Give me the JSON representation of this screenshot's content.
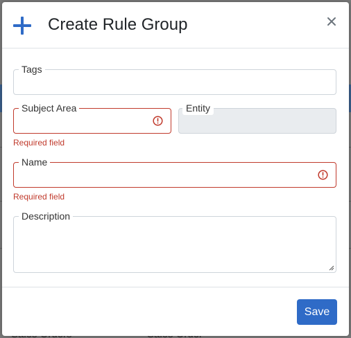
{
  "background": {
    "row_text_left": "Sales Orders",
    "row_text_right": "Sales Order",
    "row_menu": "..."
  },
  "dialog": {
    "title": "Create Rule Group",
    "icon": "plus-icon",
    "close_icon": "close-icon",
    "accent_color": "#2f6bc7",
    "error_color": "#c0392b",
    "fields": {
      "tags": {
        "label": "Tags",
        "value": ""
      },
      "subject_area": {
        "label": "Subject Area",
        "value": "",
        "error": "Required field"
      },
      "entity": {
        "label": "Entity",
        "value": "",
        "disabled": true
      },
      "name": {
        "label": "Name",
        "value": "",
        "error": "Required field"
      },
      "description": {
        "label": "Description",
        "value": ""
      }
    },
    "save_label": "Save"
  }
}
